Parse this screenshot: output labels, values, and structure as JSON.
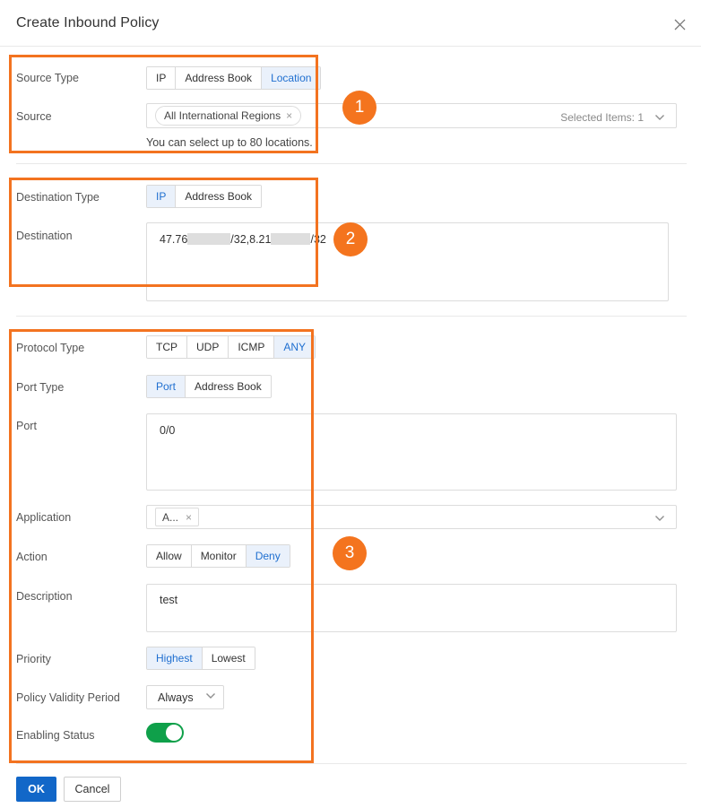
{
  "dialog": {
    "title": "Create Inbound Policy",
    "close_icon": "close-icon"
  },
  "sections": {
    "source": {
      "type_label": "Source Type",
      "type_options": [
        "IP",
        "Address Book",
        "Location"
      ],
      "type_selected": "Location",
      "source_label": "Source",
      "source_tag": "All International Regions",
      "source_tag_remove": "×",
      "selected_items_text": "Selected Items:",
      "selected_items_count": "1",
      "hint": "You can select up to 80 locations."
    },
    "destination": {
      "type_label": "Destination Type",
      "type_options": [
        "IP",
        "Address Book"
      ],
      "type_selected": "IP",
      "dest_label": "Destination",
      "dest_value_part1": "47.76",
      "dest_value_part2": "/32,8.21",
      "dest_value_part3": "/32"
    },
    "protocol": {
      "protocol_label": "Protocol Type",
      "protocol_options": [
        "TCP",
        "UDP",
        "ICMP",
        "ANY"
      ],
      "protocol_selected": "ANY",
      "port_type_label": "Port Type",
      "port_type_options": [
        "Port",
        "Address Book"
      ],
      "port_type_selected": "Port",
      "port_label": "Port",
      "port_value": "0/0",
      "application_label": "Application",
      "application_tag": "A...",
      "application_tag_remove": "×",
      "action_label": "Action",
      "action_options": [
        "Allow",
        "Monitor",
        "Deny"
      ],
      "action_selected": "Deny",
      "description_label": "Description",
      "description_value": "test",
      "priority_label": "Priority",
      "priority_options": [
        "Highest",
        "Lowest"
      ],
      "priority_selected": "Highest",
      "validity_label": "Policy Validity Period",
      "validity_value": "Always",
      "enabling_label": "Enabling Status",
      "enabling_on": true
    }
  },
  "footer": {
    "ok_label": "OK",
    "cancel_label": "Cancel"
  },
  "annotations": {
    "badge1": "1",
    "badge2": "2",
    "badge3": "3",
    "color": "#f4741e"
  }
}
